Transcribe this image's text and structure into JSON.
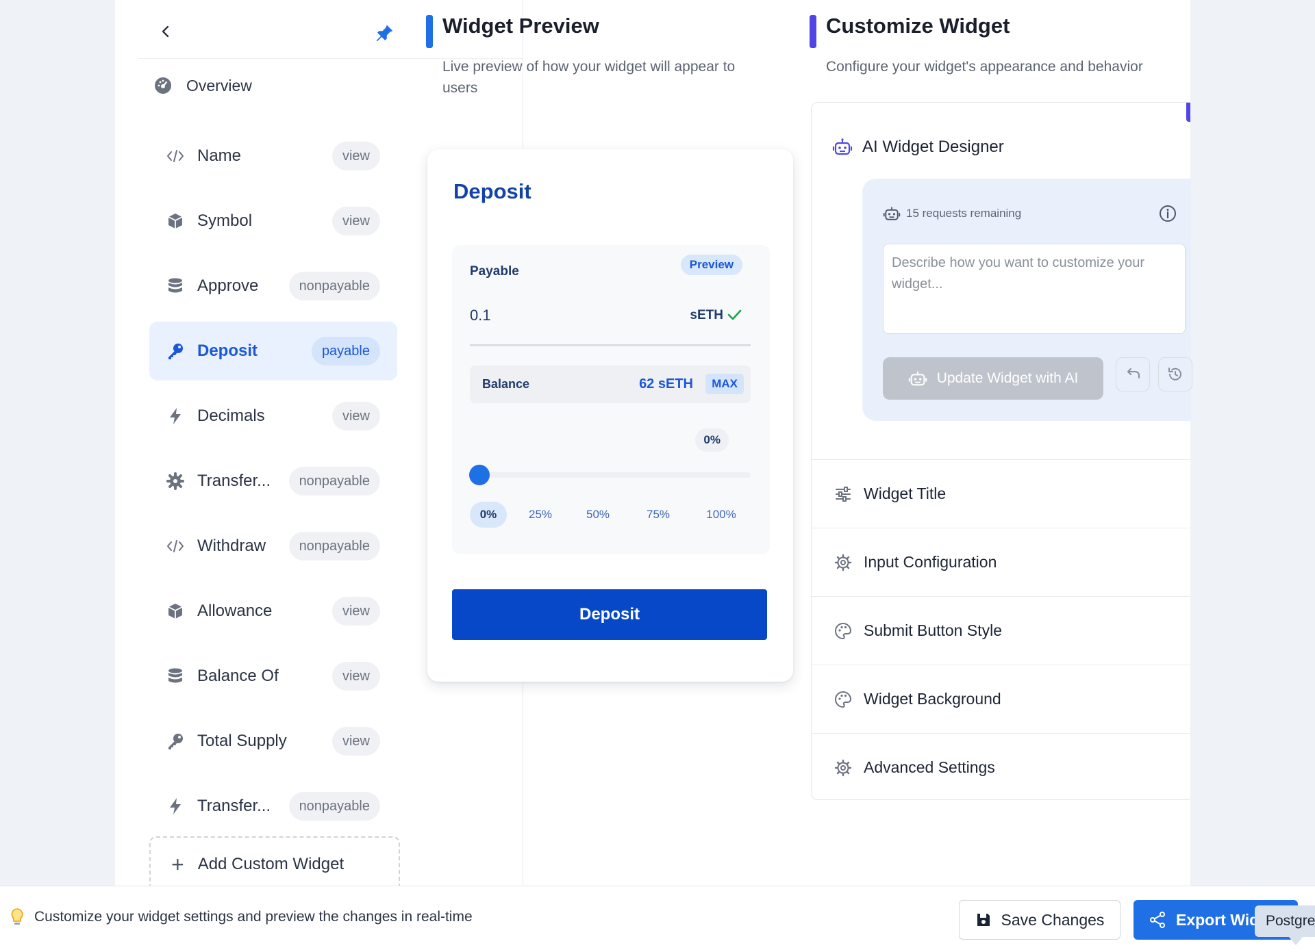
{
  "sidebar": {
    "overview_label": "Overview",
    "items": [
      {
        "label": "Name",
        "tag": "view",
        "icon": "code-icon"
      },
      {
        "label": "Symbol",
        "tag": "view",
        "icon": "cube-icon"
      },
      {
        "label": "Approve",
        "tag": "nonpayable",
        "icon": "database-icon"
      },
      {
        "label": "Deposit",
        "tag": "payable",
        "icon": "key-icon"
      },
      {
        "label": "Decimals",
        "tag": "view",
        "icon": "bolt-icon"
      },
      {
        "label": "Transfer...",
        "tag": "nonpayable",
        "icon": "gear-icon"
      },
      {
        "label": "Withdraw",
        "tag": "nonpayable",
        "icon": "code-icon"
      },
      {
        "label": "Allowance",
        "tag": "view",
        "icon": "cube-icon"
      },
      {
        "label": "Balance Of",
        "tag": "view",
        "icon": "database-icon"
      },
      {
        "label": "Total Supply",
        "tag": "view",
        "icon": "key-icon"
      },
      {
        "label": "Transfer...",
        "tag": "nonpayable",
        "icon": "bolt-icon"
      }
    ],
    "add_widget_label": "Add Custom Widget"
  },
  "preview": {
    "title": "Widget Preview",
    "subtitle": "Live preview of how your widget will appear to users",
    "accent": "#1f6fe5",
    "card": {
      "title": "Deposit",
      "payable_label": "Payable",
      "badge": "Preview",
      "amount": "0.1",
      "token": "sETH",
      "balance_label": "Balance",
      "balance_value": "62 sETH",
      "max_label": "MAX",
      "percent_bubble": "0%",
      "slider_value": 0,
      "ticks": [
        "0%",
        "25%",
        "50%",
        "75%",
        "100%"
      ],
      "submit_label": "Deposit"
    }
  },
  "customize": {
    "title": "Customize Widget",
    "subtitle": "Configure your widget's appearance and behavior",
    "accent": "#4f46e5",
    "ai": {
      "title": "AI Widget Designer",
      "requests": "15 requests remaining",
      "placeholder": "Describe how you want to customize your widget...",
      "button": "Update Widget with AI"
    },
    "sections": [
      {
        "label": "Widget Title",
        "icon": "sliders-icon"
      },
      {
        "label": "Input Configuration",
        "icon": "gear-icon"
      },
      {
        "label": "Submit Button Style",
        "icon": "palette-icon"
      },
      {
        "label": "Widget Background",
        "icon": "palette-icon"
      },
      {
        "label": "Advanced Settings",
        "icon": "gear-icon"
      }
    ]
  },
  "footer": {
    "tip": "Customize your widget settings and preview the changes in real-time",
    "save_label": "Save Changes",
    "export_label": "Export Widget",
    "tooltip": "Postgres"
  }
}
